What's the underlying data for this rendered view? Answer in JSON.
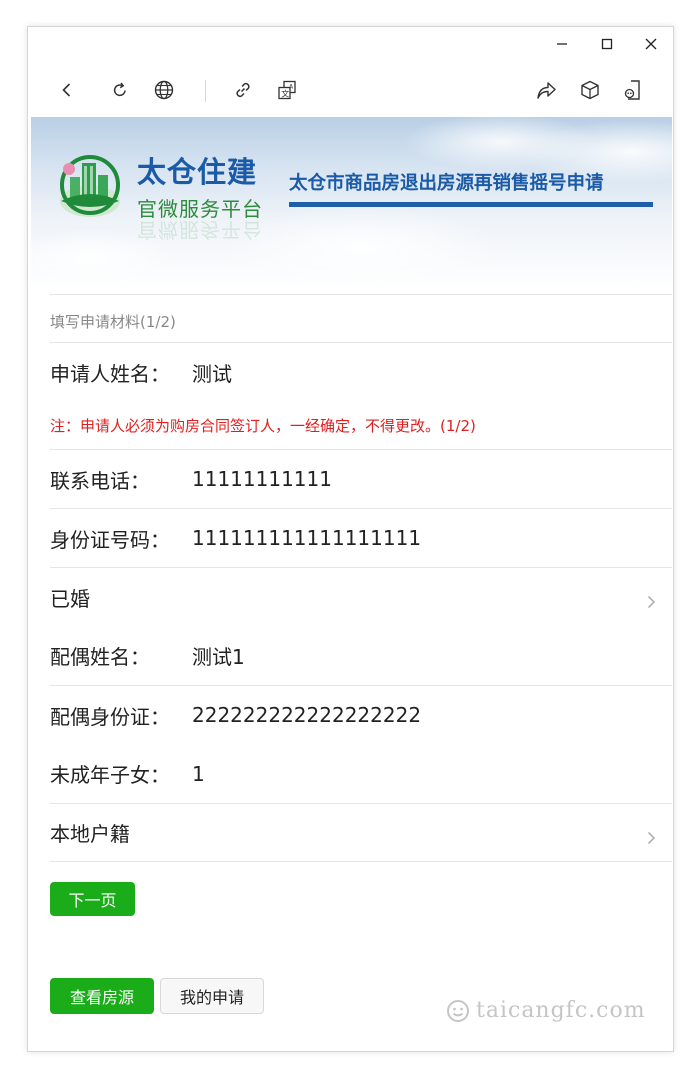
{
  "window": {
    "controls": {
      "minimize": "minimize-icon",
      "maximize": "maximize-icon",
      "close": "close-icon"
    }
  },
  "toolbar": {
    "icons": [
      "back-icon",
      "refresh-icon",
      "globe-icon",
      "link-icon",
      "translate-icon",
      "share-icon",
      "cube-icon",
      "mini-program-icon"
    ]
  },
  "banner": {
    "brand_main": "太仓住建",
    "brand_sub": "官微服务平台",
    "title": "太仓市商品房退出房源再销售摇号申请"
  },
  "form": {
    "section_title": "填写申请材料(1/2)",
    "applicant": {
      "label": "申请人姓名：",
      "value": "测试"
    },
    "note": "注：申请人必须为购房合同签订人，一经确定，不得更改。(1/2)",
    "phone": {
      "label": "联系电话：",
      "value": "11111111111"
    },
    "id_number": {
      "label": "身份证号码：",
      "value": "111111111111111111"
    },
    "marital_status": "已婚",
    "spouse_name": {
      "label": "配偶姓名：",
      "value": "测试1"
    },
    "spouse_id": {
      "label": "配偶身份证：",
      "value": "222222222222222222"
    },
    "minor_children": {
      "label": "未成年子女：",
      "value": "1"
    },
    "household_registration": "本地户籍"
  },
  "buttons": {
    "next": "下一页",
    "view_listings": "查看房源",
    "my_applications": "我的申请"
  },
  "watermark": "taicangfc.com",
  "colors": {
    "accent_green": "#1aad19",
    "brand_blue": "#1a5aa6",
    "note_red": "#e02020"
  }
}
